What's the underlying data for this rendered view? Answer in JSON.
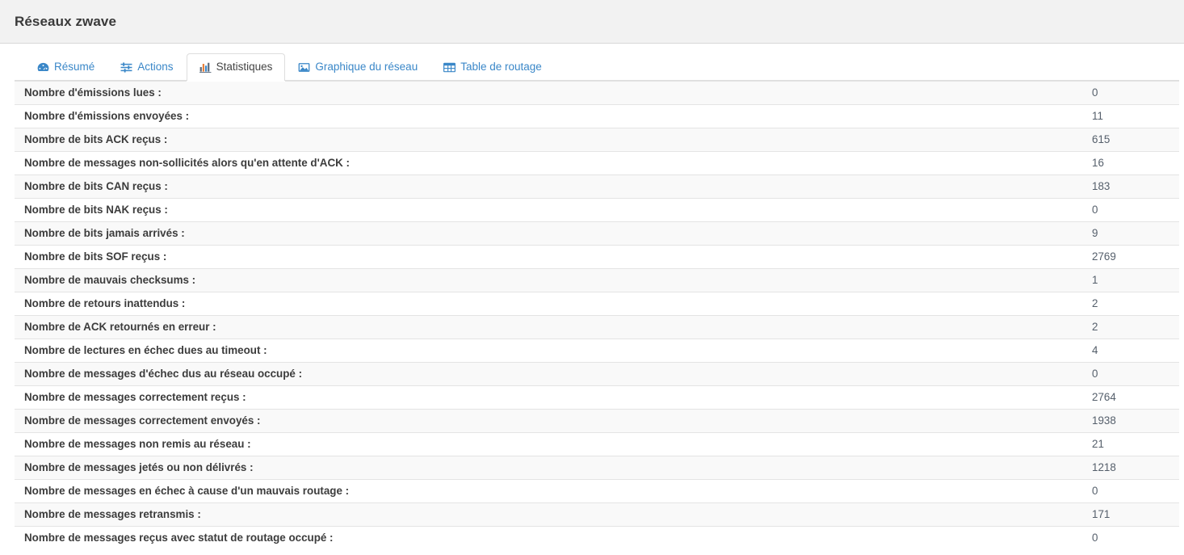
{
  "header": {
    "title": "Réseaux zwave"
  },
  "tabs": [
    {
      "label": "Résumé",
      "icon": "dashboard-icon",
      "active": false
    },
    {
      "label": "Actions",
      "icon": "sliders-icon",
      "active": false
    },
    {
      "label": "Statistiques",
      "icon": "bar-chart-icon",
      "active": true
    },
    {
      "label": "Graphique du réseau",
      "icon": "image-icon",
      "active": false
    },
    {
      "label": "Table de routage",
      "icon": "table-icon",
      "active": false
    }
  ],
  "colors": {
    "tab_link": "#3a87c8",
    "tab_active_text": "#444444",
    "label_text": "#3c3c3c",
    "value_text": "#555f6b",
    "header_bg": "#f2f2f2",
    "row_stripe": "#f9f9f9",
    "border": "#e4e4e4"
  },
  "stats": {
    "rows": [
      {
        "label": "Nombre d'émissions lues :",
        "value": "0"
      },
      {
        "label": "Nombre d'émissions envoyées :",
        "value": "11"
      },
      {
        "label": "Nombre de bits ACK reçus :",
        "value": "615"
      },
      {
        "label": "Nombre de messages non-sollicités alors qu'en attente d'ACK :",
        "value": "16"
      },
      {
        "label": "Nombre de bits CAN reçus :",
        "value": "183"
      },
      {
        "label": "Nombre de bits NAK reçus :",
        "value": "0"
      },
      {
        "label": "Nombre de bits jamais arrivés :",
        "value": "9"
      },
      {
        "label": "Nombre de bits SOF reçus :",
        "value": "2769"
      },
      {
        "label": "Nombre de mauvais checksums :",
        "value": "1"
      },
      {
        "label": "Nombre de retours inattendus :",
        "value": "2"
      },
      {
        "label": "Nombre de ACK retournés en erreur :",
        "value": "2"
      },
      {
        "label": "Nombre de lectures en échec dues au timeout :",
        "value": "4"
      },
      {
        "label": "Nombre de messages d'échec dus au réseau occupé :",
        "value": "0"
      },
      {
        "label": "Nombre de messages correctement reçus :",
        "value": "2764"
      },
      {
        "label": "Nombre de messages correctement envoyés :",
        "value": "1938"
      },
      {
        "label": "Nombre de messages non remis au réseau :",
        "value": "21"
      },
      {
        "label": "Nombre de messages jetés ou non délivrés :",
        "value": "1218"
      },
      {
        "label": "Nombre de messages en échec à cause d'un mauvais routage :",
        "value": "0"
      },
      {
        "label": "Nombre de messages retransmis :",
        "value": "171"
      },
      {
        "label": "Nombre de messages reçus avec statut de routage occupé :",
        "value": "0"
      }
    ]
  }
}
